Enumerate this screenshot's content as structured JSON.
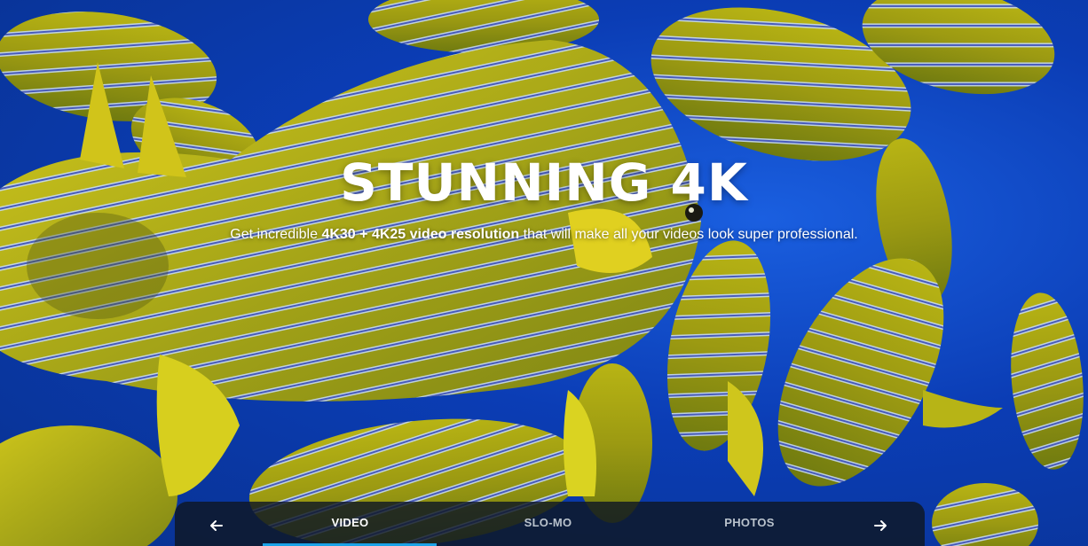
{
  "hero": {
    "headline": "STUNNING 4K",
    "subtitle_before": "Get incredible ",
    "subtitle_strong": "4K30 + 4K25 video resolution",
    "subtitle_after": " that will make all your videos look super professional."
  },
  "tabs": {
    "items": [
      {
        "label": "VIDEO",
        "active": true
      },
      {
        "label": "SLO-MO",
        "active": false
      },
      {
        "label": "PHOTOS",
        "active": false
      }
    ],
    "prev_icon": "arrow-left-icon",
    "next_icon": "arrow-right-icon"
  },
  "colors": {
    "water": "#0b3db5",
    "fish_yellow": "#c9c21a",
    "stripe": "#b9d4ff",
    "tabbar_bg": "#0f1723",
    "indicator": "#1aa3e8"
  }
}
